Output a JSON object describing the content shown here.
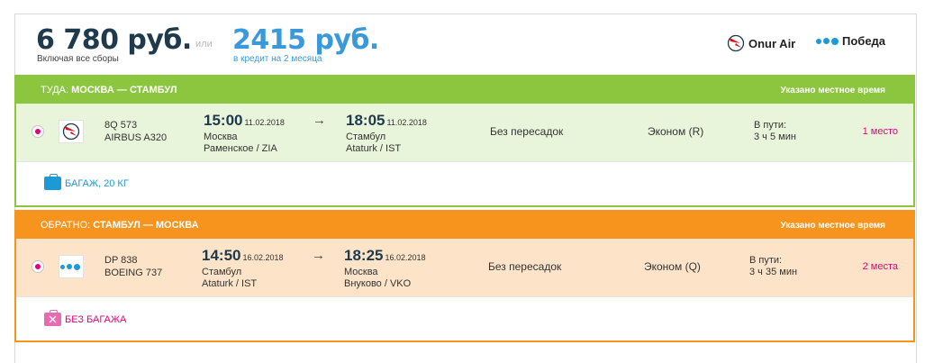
{
  "header": {
    "price_full": "6 780 руб.",
    "price_full_note": "Включая все сборы",
    "or_label": "или",
    "price_credit": "2415 руб.",
    "price_credit_note": "в кредит на 2 месяца",
    "airlines": [
      {
        "name": "Onur Air",
        "icon": "onur-air-logo-icon"
      },
      {
        "name": "Победа",
        "icon": "pobeda-dots-icon"
      }
    ]
  },
  "segments": [
    {
      "direction_label": "ТУДА:",
      "route": "МОСКВА — СТАМБУЛ",
      "local_time_note": "Указано местное время",
      "color": "#8cc63f",
      "flight_number": "8Q 573",
      "aircraft": "AIRBUS A320",
      "depart_time": "15:00",
      "depart_date": "11.02.2018",
      "depart_city": "Москва",
      "depart_airport": "Раменское / ZIA",
      "arrow": "→",
      "arrive_time": "18:05",
      "arrive_date": "11.02.2018",
      "arrive_city": "Стамбул",
      "arrive_airport": "Ataturk / IST",
      "stops": "Без пересадок",
      "cabin": "Эконом (R)",
      "duration_label": "В пути:",
      "duration": "3 ч 5 мин",
      "seats": "1 место",
      "baggage": "БАГАЖ, 20 КГ",
      "baggage_icon": "suitcase-icon"
    },
    {
      "direction_label": "ОБРАТНО:",
      "route": "СТАМБУЛ — МОСКВА",
      "local_time_note": "Указано местное время",
      "color": "#f7941d",
      "flight_number": "DP 838",
      "aircraft": "BOEING 737",
      "depart_time": "14:50",
      "depart_date": "16.02.2018",
      "depart_city": "Стамбул",
      "depart_airport": "Ataturk / IST",
      "arrow": "→",
      "arrive_time": "18:25",
      "arrive_date": "16.02.2018",
      "arrive_city": "Москва",
      "arrive_airport": "Внуково / VKO",
      "stops": "Без пересадок",
      "cabin": "Эконом (Q)",
      "duration_label": "В пути:",
      "duration": "3 ч 35 мин",
      "seats": "2 места",
      "baggage": "БЕЗ БАГАЖА",
      "baggage_icon": "no-baggage-icon"
    }
  ],
  "colors": {
    "price_dark": "#1f3a4d",
    "price_credit": "#3a9ad9",
    "accent_pink": "#e6007e",
    "baggage_blue": "#1b9ad6"
  }
}
